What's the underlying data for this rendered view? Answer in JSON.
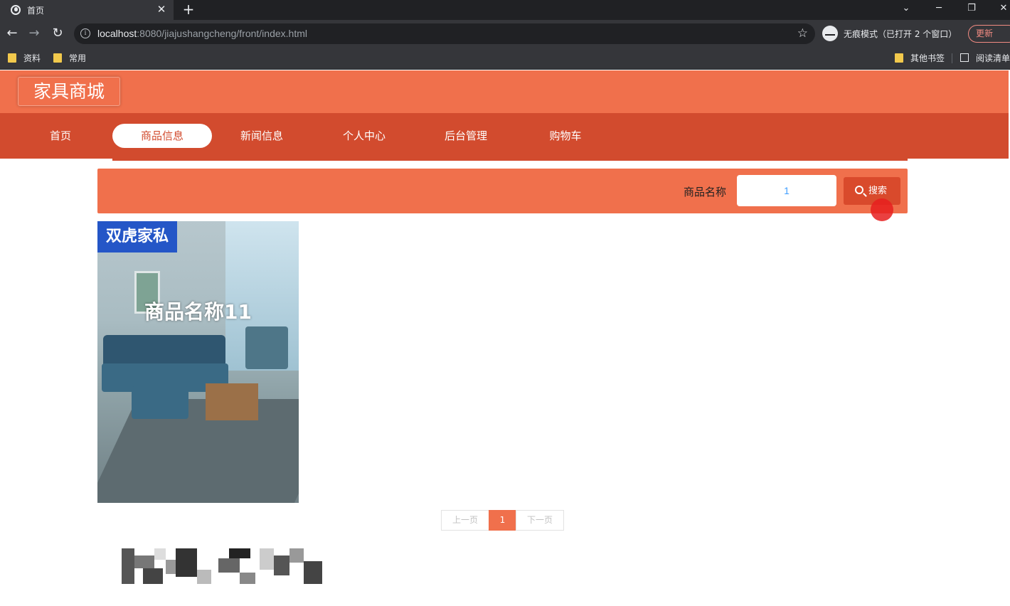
{
  "browser": {
    "tab_title": "首页",
    "new_tab_symbol": "+",
    "url_host": "localhost",
    "url_rest": ":8080/jiajushangcheng/front/index.html",
    "incognito_label": "无痕模式（已打开 2 个窗口）",
    "update_label": "更新",
    "bookmarks": [
      "资料",
      "常用"
    ],
    "bookmarks_right": [
      "其他书签",
      "阅读清单"
    ]
  },
  "site": {
    "brand": "家具商城",
    "nav": [
      {
        "label": "首页",
        "active": false
      },
      {
        "label": "商品信息",
        "active": true
      },
      {
        "label": "新闻信息",
        "active": false
      },
      {
        "label": "个人中心",
        "active": false
      },
      {
        "label": "后台管理",
        "active": false
      },
      {
        "label": "购物车",
        "active": false
      }
    ],
    "search": {
      "label": "商品名称",
      "value": "1",
      "button": "搜索"
    },
    "product": {
      "brand_tag": "双虎家私",
      "title": "商品名称11"
    },
    "pager": {
      "prev": "上一页",
      "current": "1",
      "next": "下一页"
    }
  },
  "colors": {
    "primary": "#f0704c",
    "nav_bg": "#d24b2e",
    "search_btn": "#d94a2c",
    "brand_tag": "#2456c7"
  }
}
